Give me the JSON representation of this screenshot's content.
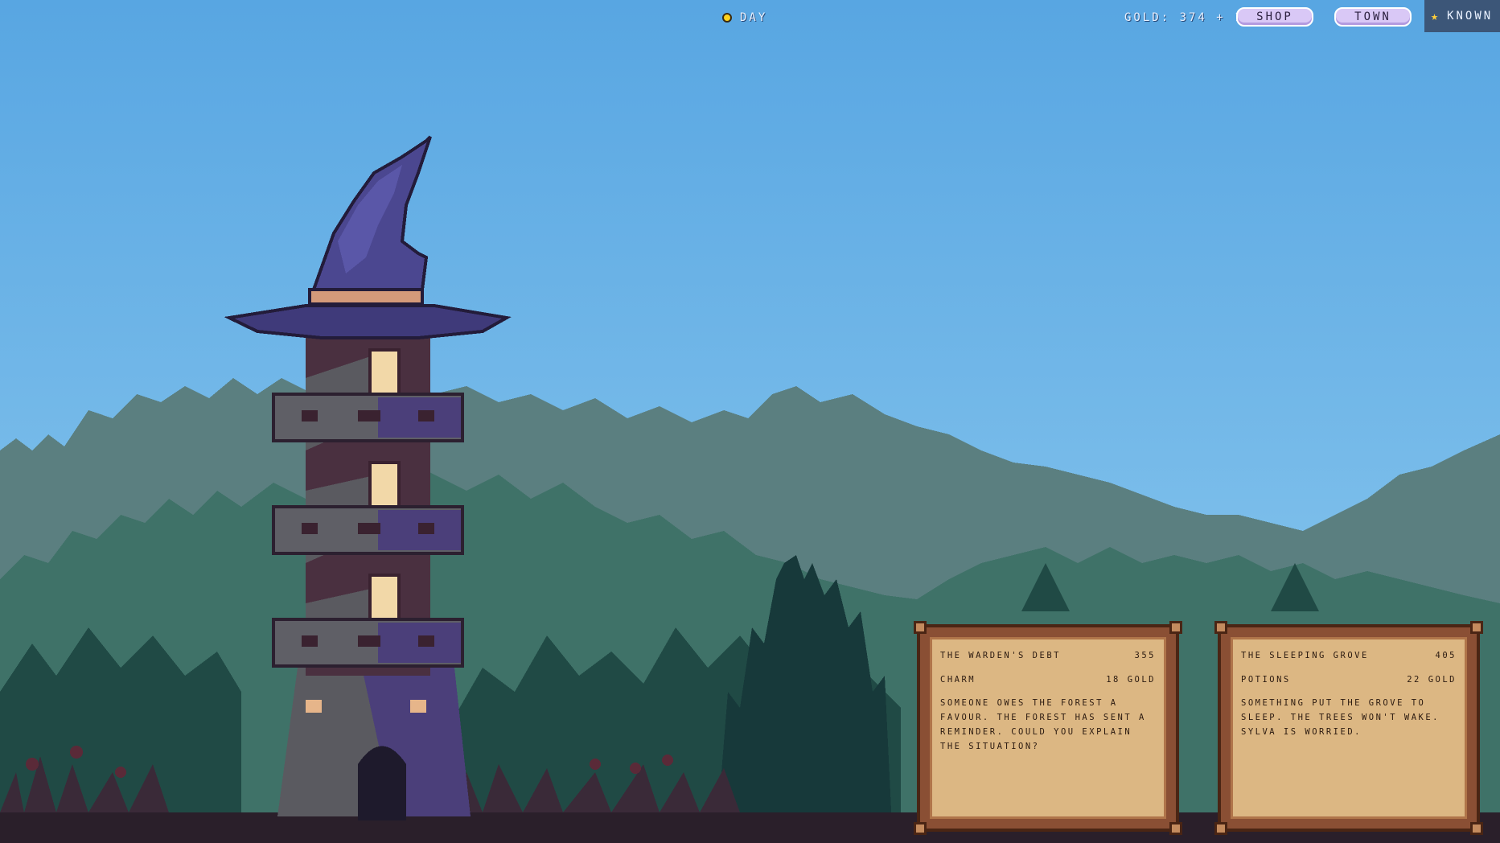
{
  "hud": {
    "time_of_day": "DAY",
    "gold": "GOLD: 374 + 1",
    "shop_label": "SHOP",
    "town_label": "TOWN",
    "known_label": "KNOWN"
  },
  "icons": {
    "time": "sun-icon",
    "known": "star-icon"
  },
  "colors": {
    "sky_top": "#5aa9e3",
    "sky_bottom": "#8cc8ef",
    "button_bg": "#d9c8f6",
    "card_wood": "#8a4f34",
    "card_paper": "#dcb783"
  },
  "quests": [
    {
      "title": "THE WARDEN'S DEBT",
      "code": "355",
      "category": "CHARM",
      "reward": "18 GOLD",
      "description": "SOMEONE OWES THE FOREST A FAVOUR. THE FOREST HAS SENT A REMINDER. COULD YOU EXPLAIN THE SITUATION?"
    },
    {
      "title": "THE SLEEPING GROVE",
      "code": "405",
      "category": "POTIONS",
      "reward": "22 GOLD",
      "description": "SOMETHING PUT THE GROVE TO SLEEP. THE TREES WON'T WAKE. SYLVA IS WORRIED."
    }
  ]
}
